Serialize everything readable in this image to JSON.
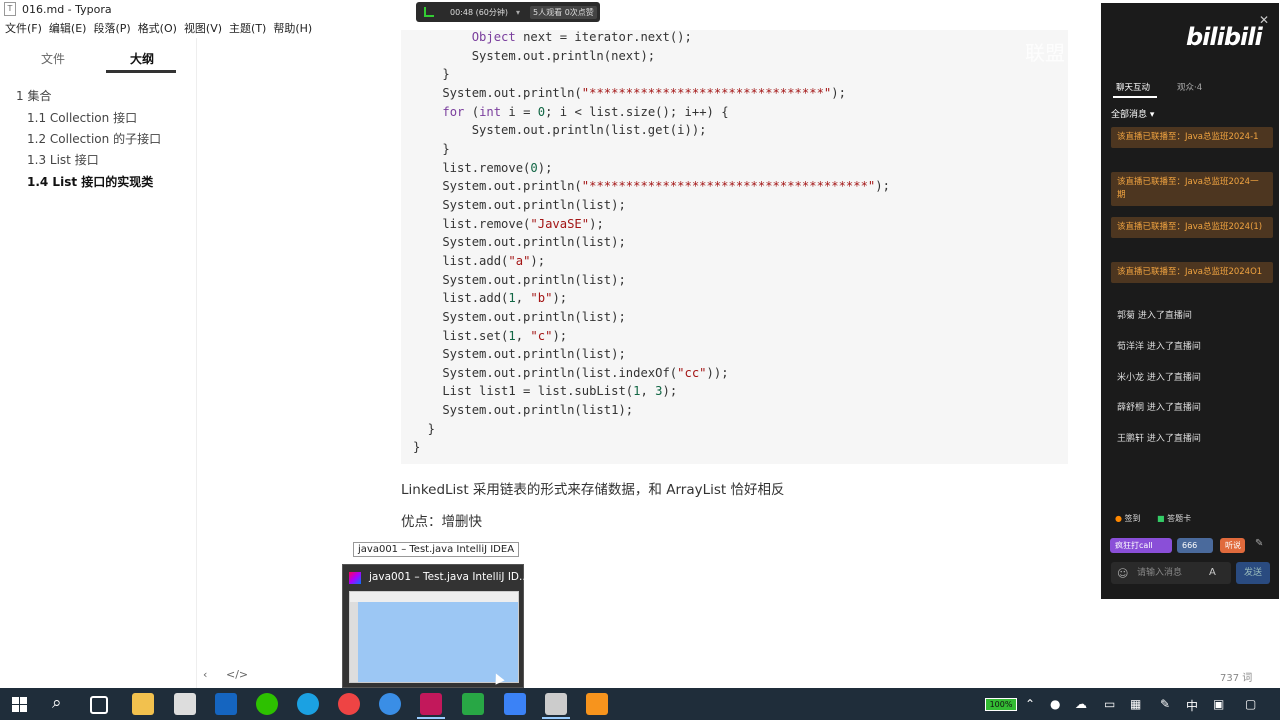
{
  "window": {
    "title": "016.md - Typora"
  },
  "menu": [
    "文件(F)",
    "编辑(E)",
    "段落(P)",
    "格式(O)",
    "视图(V)",
    "主题(T)",
    "帮助(H)"
  ],
  "live_bar": {
    "time": "00:48 (60分钟)",
    "dropdown": "▾",
    "viewers": "5人观看",
    "likes": "0次点赞"
  },
  "sidebar": {
    "tab_files": "文件",
    "tab_outline": "大纲",
    "outline": [
      {
        "label": "1 集合",
        "active": false
      },
      {
        "label": "1.1 Collection 接口",
        "active": false
      },
      {
        "label": "1.2 Collection 的子接口",
        "active": false
      },
      {
        "label": "1.3 List 接口",
        "active": false
      },
      {
        "label": "1.4 List 接口的实现类",
        "active": true
      }
    ],
    "prev": "‹",
    "source": "</>"
  },
  "code_lines": [
    [
      [
        "        ",
        ""
      ],
      [
        "Object",
        "kw"
      ],
      [
        " next = iterator.next();",
        ""
      ]
    ],
    [
      [
        "        System.out.println(next);",
        ""
      ]
    ],
    [
      [
        "    }",
        ""
      ]
    ],
    [
      [
        "    System.out.println(",
        ""
      ],
      [
        "\"********************************\"",
        "str"
      ],
      [
        ");",
        ""
      ]
    ],
    [
      [
        "    ",
        ""
      ],
      [
        "for",
        "kw"
      ],
      [
        " (",
        ""
      ],
      [
        "int",
        "kw"
      ],
      [
        " i = ",
        ""
      ],
      [
        "0",
        "num"
      ],
      [
        "; i < list.size(); i++) {",
        ""
      ]
    ],
    [
      [
        "        System.out.println(list.get(i));",
        ""
      ]
    ],
    [
      [
        "    }",
        ""
      ]
    ],
    [
      [
        "    list.remove(",
        ""
      ],
      [
        "0",
        "num"
      ],
      [
        ");",
        ""
      ]
    ],
    [
      [
        "    System.out.println(",
        ""
      ],
      [
        "\"**************************************\"",
        "str"
      ],
      [
        ");",
        ""
      ]
    ],
    [
      [
        "    System.out.println(list);",
        ""
      ]
    ],
    [
      [
        "    list.remove(",
        ""
      ],
      [
        "\"JavaSE\"",
        "str"
      ],
      [
        ");",
        ""
      ]
    ],
    [
      [
        "    System.out.println(list);",
        ""
      ]
    ],
    [
      [
        "    list.add(",
        ""
      ],
      [
        "\"a\"",
        "str"
      ],
      [
        ");",
        ""
      ]
    ],
    [
      [
        "    System.out.println(list);",
        ""
      ]
    ],
    [
      [
        "    list.add(",
        ""
      ],
      [
        "1",
        "num"
      ],
      [
        ", ",
        ""
      ],
      [
        "\"b\"",
        "str"
      ],
      [
        ");",
        ""
      ]
    ],
    [
      [
        "    System.out.println(list);",
        ""
      ]
    ],
    [
      [
        "    list.set(",
        ""
      ],
      [
        "1",
        "num"
      ],
      [
        ", ",
        ""
      ],
      [
        "\"c\"",
        "str"
      ],
      [
        ");",
        ""
      ]
    ],
    [
      [
        "    System.out.println(list);",
        ""
      ]
    ],
    [
      [
        "    System.out.println(list.indexOf(",
        ""
      ],
      [
        "\"cc\"",
        "str"
      ],
      [
        "));",
        ""
      ]
    ],
    [
      [
        "    List list1 = list.subList(",
        ""
      ],
      [
        "1",
        "num"
      ],
      [
        ", ",
        ""
      ],
      [
        "3",
        "num"
      ],
      [
        ");",
        ""
      ]
    ],
    [
      [
        "    System.out.println(list1);",
        ""
      ]
    ],
    [
      [
        "  }",
        ""
      ]
    ],
    [
      [
        "}",
        ""
      ]
    ]
  ],
  "paragraphs": {
    "linkedlist": "LinkedList 采用链表的形式来存储数据，和 ArrayList 恰好相反",
    "pros": "优点：增删快"
  },
  "status": {
    "word_count": "737 词"
  },
  "taskbar_preview": {
    "tooltip": "java001 – Test.java IntelliJ IDEA",
    "title": "java001 – Test.java IntelliJ ID..."
  },
  "bilibili": {
    "logo": "bilibili",
    "union": "联盟",
    "close": "✕",
    "tab_chat": "聊天互动",
    "tab_audience": "观众·4",
    "filter": "全部消息 ▾",
    "system_messages": [
      "该直播已联播至：Java总监班2024-1",
      "该直播已联播至：Java总监班2024一期",
      "该直播已联播至：Java总监班2024(1)",
      "该直播已联播至：Java总监班2024O1"
    ],
    "entries": [
      "郭菊 进入了直播间",
      "荀洋洋 进入了直播间",
      "米小龙 进入了直播间",
      "薛舒桐 进入了直播间",
      "王鹏轩 进入了直播间"
    ],
    "checkin": "签到",
    "manage": "答题卡",
    "btn_call": "疯狂打call",
    "btn_666": "666",
    "btn_more": "听说",
    "input_placeholder": "请输入消息",
    "font_btn": "A",
    "send": "发送"
  },
  "tray": {
    "battery": "100%",
    "ime": "中"
  },
  "colors": {
    "accent_bili": "#f0a340",
    "taskbar": "#1f2d3a"
  }
}
